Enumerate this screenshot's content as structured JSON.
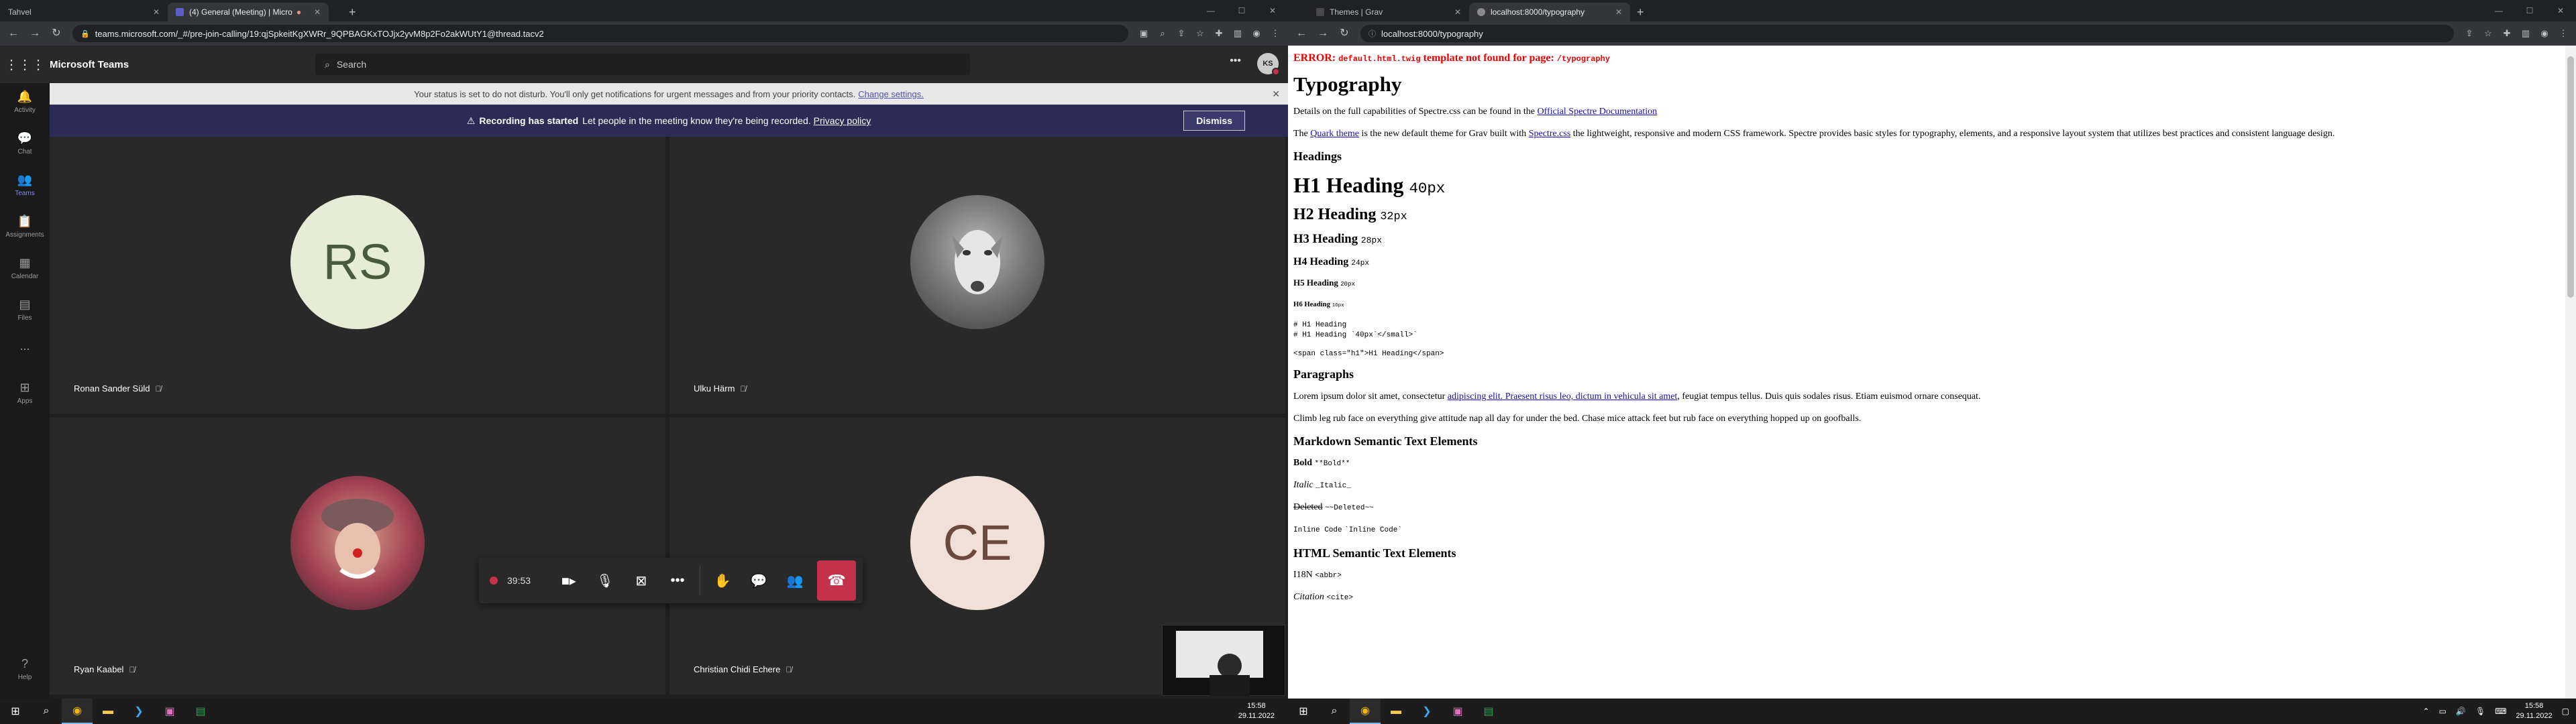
{
  "left_browser": {
    "tabs": [
      {
        "title": "Tahvel",
        "fav_color": "#3c7cd6",
        "active": false
      },
      {
        "title": "(4) General (Meeting) | Micro",
        "fav_color": "#5b5fc7",
        "active": true
      },
      {
        "title": "",
        "fav_color": "",
        "active": false
      }
    ],
    "url": "teams.microsoft.com/_#/pre-join-calling/19:qjSpkeitKgXWRr_9QPBAGKxTOJjx2yvM8p2Fo2akWUtY1@thread.tacv2"
  },
  "teams": {
    "app_name": "Microsoft Teams",
    "search_placeholder": "Search",
    "avatar_initials": "KS",
    "rail": [
      {
        "label": "Activity",
        "icon": "bell-icon"
      },
      {
        "label": "Chat",
        "icon": "chat-icon"
      },
      {
        "label": "Teams",
        "icon": "teams-icon"
      },
      {
        "label": "Assignments",
        "icon": "assignments-icon"
      },
      {
        "label": "Calendar",
        "icon": "calendar-icon"
      },
      {
        "label": "Files",
        "icon": "files-icon"
      },
      {
        "label": "...",
        "icon": "more-icon"
      },
      {
        "label": "Apps",
        "icon": "apps-icon"
      }
    ],
    "rail_help": "Help",
    "status_banner": {
      "text": "Your status is set to do not disturb. You'll only get notifications for urgent messages and from your priority contacts.",
      "link": "Change settings."
    },
    "recording_banner": {
      "bold": "Recording has started",
      "text": "Let people in the meeting know they're being recorded.",
      "link": "Privacy policy",
      "dismiss": "Dismiss"
    },
    "participants": [
      {
        "name": "Ronan Sander Süld",
        "initials": "RS",
        "bg": "#e6ecd6",
        "fg": "#4a5a3c"
      },
      {
        "name": "Ulku Härm",
        "initials": "",
        "bg": "#6a6a6a",
        "fg": "#fff"
      },
      {
        "name": "Ryan Kaabel",
        "initials": "",
        "bg": "#8a3040",
        "fg": "#fff"
      },
      {
        "name": "Christian Chidi Echere",
        "initials": "CE",
        "bg": "#f0e0d8",
        "fg": "#6b4a3e"
      }
    ],
    "call_timer": "39:53"
  },
  "right_browser": {
    "tabs": [
      {
        "title": "Themes | Grav",
        "fav_color": "#4a4a4a",
        "active": false
      },
      {
        "title": "localhost:8000/typography",
        "fav_color": "#8a8a8a",
        "active": true
      }
    ],
    "url": "localhost:8000/typography"
  },
  "page": {
    "error_prefix": "ERROR:",
    "error_file": "default.html.twig",
    "error_mid": "template not found for page:",
    "error_path": "/typography",
    "title": "Typography",
    "intro_text": "Details on the full capabilities of Spectre.css can be found in the",
    "intro_link": "Official Spectre Documentation",
    "quark_pre": "The",
    "quark_link": "Quark theme",
    "quark_mid": "is the new default theme for Grav built with",
    "spectre_link": "Spectre.css",
    "quark_post": "the lightweight, responsive and modern CSS framework. Spectre provides basic styles for typography, elements, and a responsive layout system that utilizes best practices and consistent language design.",
    "headings_title": "Headings",
    "h1": "H1 Heading",
    "h1_small": "40px",
    "h2": "H2 Heading",
    "h2_small": "32px",
    "h3": "H3 Heading",
    "h3_small": "28px",
    "h4": "H4 Heading",
    "h4_small": "24px",
    "h5": "H5 Heading",
    "h5_small": "20px",
    "h6": "H6 Heading",
    "h6_small": "16px",
    "code1": "# H1 Heading\n# H1 Heading `40px`</small>`",
    "code2": "<span class=\"h1\">H1 Heading</span>",
    "paragraphs_title": "Paragraphs",
    "lorem_pre": "Lorem ipsum dolor sit amet, consectetur",
    "lorem_link": "adipiscing elit. Praesent risus leo, dictum in vehicula sit amet",
    "lorem_post": ", feugiat tempus tellus. Duis quis sodales risus. Etiam euismod ornare consequat.",
    "climb": "Climb leg rub face on everything give attitude nap all day for under the bed. Chase mice attack feet but rub face on everything hopped up on goofballs.",
    "md_title": "Markdown Semantic Text Elements",
    "bold": "Bold",
    "bold_code": "**Bold**",
    "italic": "Italic",
    "italic_code": "_Italic_",
    "deleted": "Deleted",
    "deleted_code": "~~Deleted~~",
    "inline": "Inline Code",
    "inline_code": "`Inline Code`",
    "html_title": "HTML Semantic Text Elements",
    "abbr": "I18N",
    "abbr_code": "<abbr>",
    "cite": "Citation",
    "cite_code": "<cite>"
  },
  "taskbar": {
    "time": "15:58",
    "date": "29.11.2022"
  }
}
